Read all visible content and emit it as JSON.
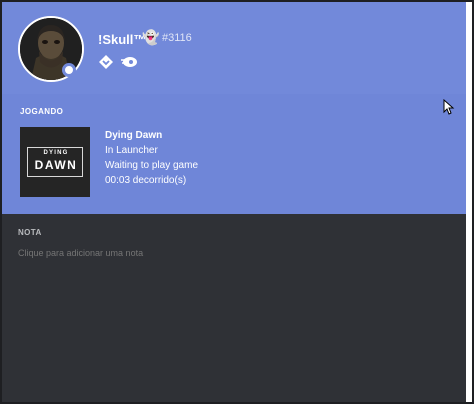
{
  "profile": {
    "username": "!Skull™",
    "emoji": "👻",
    "discriminator": "#3116",
    "status": "online"
  },
  "badges": [
    {
      "icon": "hypesquad-icon"
    },
    {
      "icon": "nitro-icon"
    }
  ],
  "activity": {
    "label": "JOGANDO",
    "game": {
      "art_top": "DYING",
      "art_bottom": "DAWN",
      "title": "Dying Dawn",
      "details": "In Launcher",
      "state": "Waiting to play game",
      "elapsed": "00:03 decorrido(s)"
    }
  },
  "notes": {
    "label": "NOTA",
    "placeholder": "Clique para adicionar uma nota"
  },
  "colors": {
    "header_bg": "#7289da",
    "activity_bg": "#6f86d8",
    "panel_bg": "#2f3136",
    "status_online": "#ffffff"
  }
}
